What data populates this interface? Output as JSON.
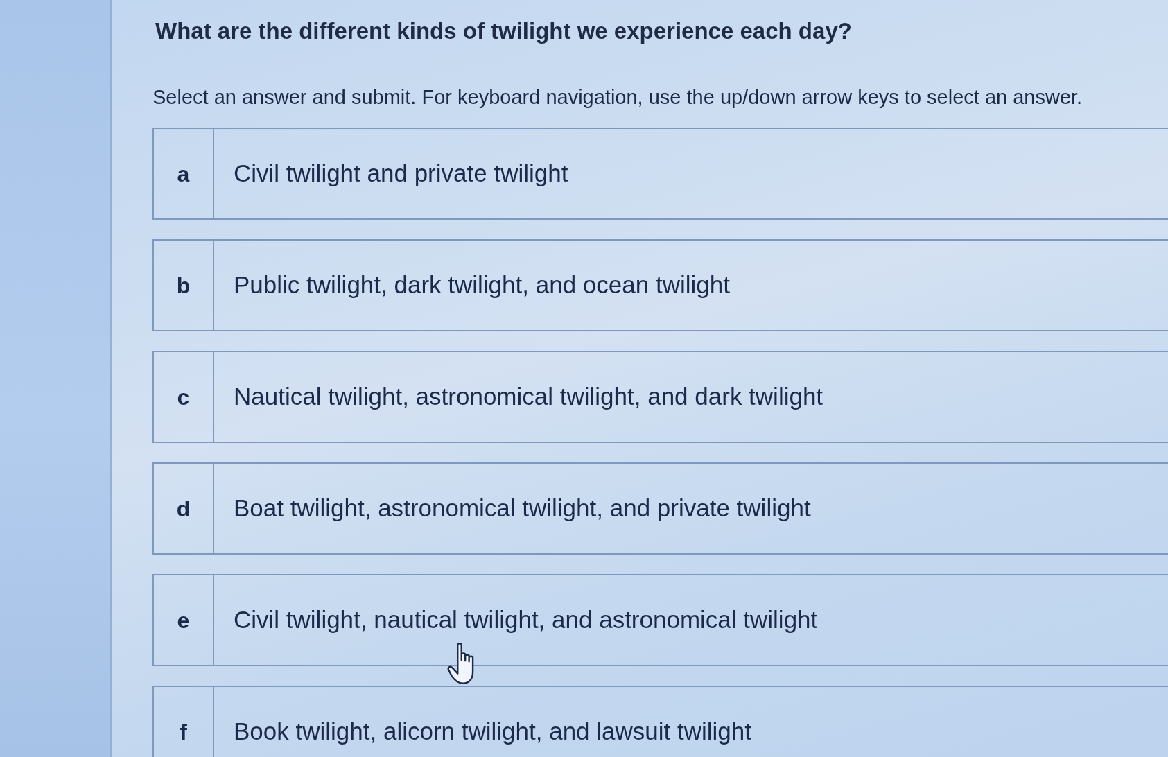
{
  "question": {
    "title": "What are the different kinds of twilight we experience each day?",
    "instruction": "Select an answer and submit. For keyboard navigation, use the up/down arrow keys to select an answer."
  },
  "options": [
    {
      "letter": "a",
      "text": "Civil twilight and private twilight",
      "selected": false
    },
    {
      "letter": "b",
      "text": "Public twilight, dark twilight, and ocean twilight",
      "selected": false
    },
    {
      "letter": "c",
      "text": "Nautical twilight, astronomical twilight, and dark twilight",
      "selected": false
    },
    {
      "letter": "d",
      "text": "Boat twilight, astronomical twilight, and private twilight",
      "selected": false
    },
    {
      "letter": "e",
      "text": "Civil twilight, nautical twilight, and astronomical twilight",
      "selected": false
    },
    {
      "letter": "f",
      "text": "Book twilight, alicorn twilight, and lawsuit twilight",
      "selected": false
    }
  ]
}
